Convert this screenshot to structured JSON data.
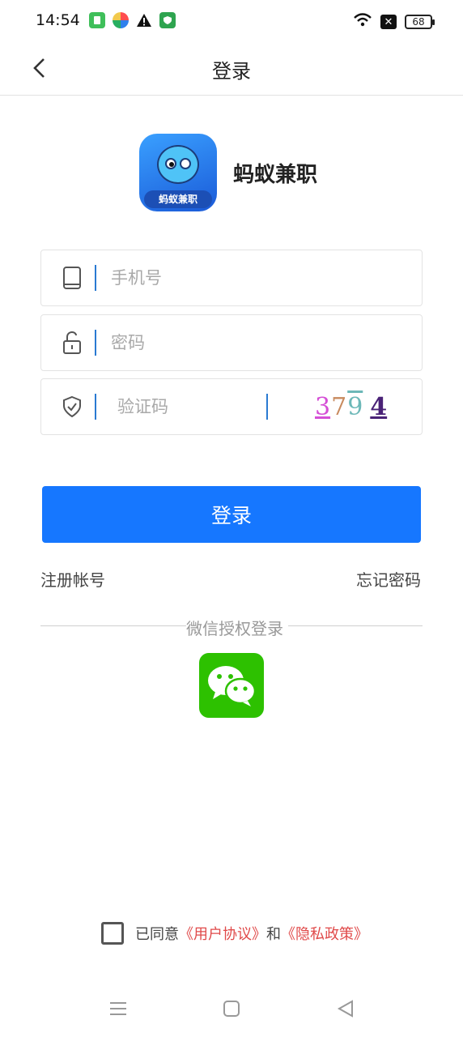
{
  "status_bar": {
    "time": "14:54",
    "battery": "68",
    "icons": [
      "app-notification-icon",
      "colorful-app-icon",
      "warning-icon",
      "shield-icon",
      "wifi-icon",
      "close-box-icon",
      "battery-icon"
    ]
  },
  "nav": {
    "title": "登录",
    "back_icon": "chevron-left-icon"
  },
  "app": {
    "name": "蚂蚁兼职",
    "logo_banner": "蚂蚁兼职"
  },
  "form": {
    "phone_placeholder": "手机号",
    "password_placeholder": "密码",
    "captcha_placeholder": "验证码",
    "captcha_digits": [
      "3",
      "7",
      "9",
      "4"
    ]
  },
  "actions": {
    "login_label": "登录",
    "register_label": "注册帐号",
    "forgot_label": "忘记密码"
  },
  "wechat": {
    "label": "微信授权登录"
  },
  "agreement": {
    "prefix": "已同意",
    "user_agreement": "《用户协议》",
    "and": "和",
    "privacy_policy": "《隐私政策》"
  },
  "colors": {
    "primary": "#1677ff",
    "wechat_green": "#2dc100",
    "link_red": "#e04a4a"
  }
}
